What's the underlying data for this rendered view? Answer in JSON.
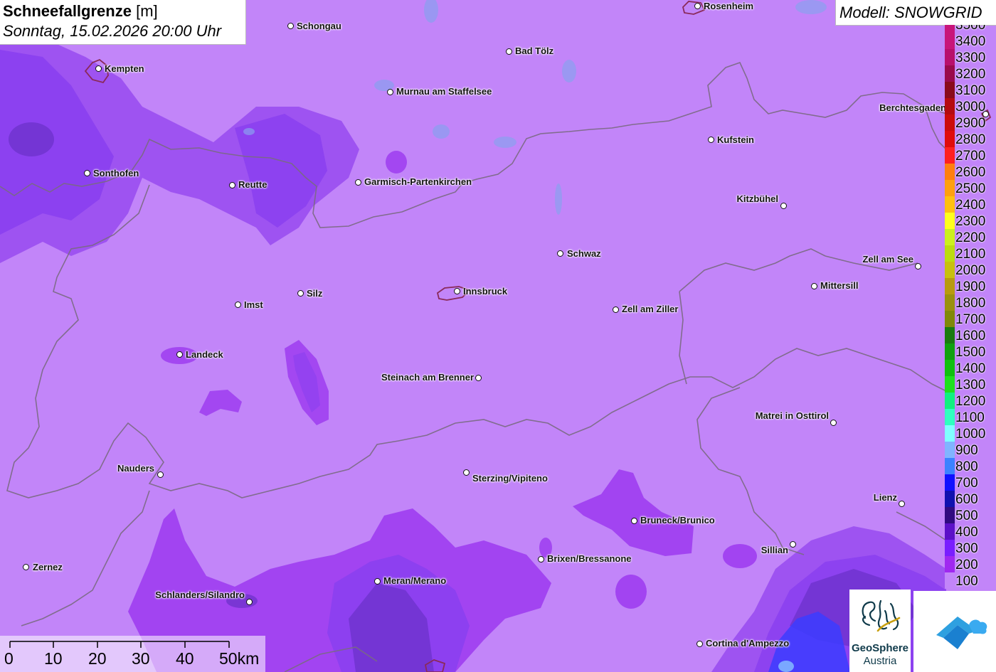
{
  "title": {
    "main": "Schneefallgrenze",
    "unit": "[m]",
    "datetime": "Sonntag, 15.02.2026 20:00 Uhr"
  },
  "model_label": "Modell: SNOWGRID",
  "legend": [
    {
      "value": "3500",
      "color": "#c8157a"
    },
    {
      "value": "3400",
      "color": "#c8157a"
    },
    {
      "value": "3300",
      "color": "#b80f6c"
    },
    {
      "value": "3200",
      "color": "#9a0a4c"
    },
    {
      "value": "3100",
      "color": "#8a0a1c"
    },
    {
      "value": "3000",
      "color": "#b50a10"
    },
    {
      "value": "2900",
      "color": "#cc0b0b"
    },
    {
      "value": "2800",
      "color": "#e00c0c"
    },
    {
      "value": "2700",
      "color": "#ff2020"
    },
    {
      "value": "2600",
      "color": "#ff7f10"
    },
    {
      "value": "2500",
      "color": "#ffa010"
    },
    {
      "value": "2400",
      "color": "#ffc010"
    },
    {
      "value": "2300",
      "color": "#ffff1e"
    },
    {
      "value": "2200",
      "color": "#ccf01e"
    },
    {
      "value": "2100",
      "color": "#bcdc10"
    },
    {
      "value": "2000",
      "color": "#c8c010"
    },
    {
      "value": "1900",
      "color": "#b89a10"
    },
    {
      "value": "1800",
      "color": "#9a9010"
    },
    {
      "value": "1700",
      "color": "#80880a"
    },
    {
      "value": "1600",
      "color": "#1a7a10"
    },
    {
      "value": "1500",
      "color": "#10a010"
    },
    {
      "value": "1400",
      "color": "#10c010"
    },
    {
      "value": "1300",
      "color": "#1ee01e"
    },
    {
      "value": "1200",
      "color": "#10f080"
    },
    {
      "value": "1100",
      "color": "#30ffc0"
    },
    {
      "value": "1000",
      "color": "#80ffff"
    },
    {
      "value": "900",
      "color": "#80b4ff"
    },
    {
      "value": "800",
      "color": "#3c82ff"
    },
    {
      "value": "700",
      "color": "#1010ff"
    },
    {
      "value": "600",
      "color": "#1010b0"
    },
    {
      "value": "500",
      "color": "#300a80"
    },
    {
      "value": "400",
      "color": "#5c10c8"
    },
    {
      "value": "300",
      "color": "#7a1eff"
    },
    {
      "value": "200",
      "color": "#a028f0"
    },
    {
      "value": "100",
      "color": "#c285f9"
    }
  ],
  "cities": [
    {
      "name": "Rosenheim",
      "label_side": "right"
    },
    {
      "name": "Schongau",
      "label_side": "right"
    },
    {
      "name": "Bad Tölz",
      "label_side": "right"
    },
    {
      "name": "Kempten",
      "label_side": "right"
    },
    {
      "name": "Murnau am Staffelsee",
      "label_side": "right"
    },
    {
      "name": "Berchtesgaden",
      "label_side": "left"
    },
    {
      "name": "Kufstein",
      "label_side": "right"
    },
    {
      "name": "Sonthofen",
      "label_side": "right"
    },
    {
      "name": "Reutte",
      "label_side": "right"
    },
    {
      "name": "Garmisch-Partenkirchen",
      "label_side": "right"
    },
    {
      "name": "Kitzbühel",
      "label_side": "left"
    },
    {
      "name": "Schwaz",
      "label_side": "right"
    },
    {
      "name": "Zell am See",
      "label_side": "left"
    },
    {
      "name": "Mittersill",
      "label_side": "right"
    },
    {
      "name": "Innsbruck",
      "label_side": "right"
    },
    {
      "name": "Silz",
      "label_side": "right"
    },
    {
      "name": "Imst",
      "label_side": "right"
    },
    {
      "name": "Zell am Ziller",
      "label_side": "right"
    },
    {
      "name": "Landeck",
      "label_side": "right"
    },
    {
      "name": "Steinach am Brenner",
      "label_side": "left"
    },
    {
      "name": "Matrei in Osttirol",
      "label_side": "left"
    },
    {
      "name": "Nauders",
      "label_side": "left"
    },
    {
      "name": "Sterzing/Vipiteno",
      "label_side": "right"
    },
    {
      "name": "Lienz",
      "label_side": "left"
    },
    {
      "name": "Bruneck/Brunico",
      "label_side": "right"
    },
    {
      "name": "Sillian",
      "label_side": "left"
    },
    {
      "name": "Brixen/Bressanone",
      "label_side": "right"
    },
    {
      "name": "Zernez",
      "label_side": "right"
    },
    {
      "name": "Meran/Merano",
      "label_side": "right"
    },
    {
      "name": "Schlanders/Silandro",
      "label_side": "left"
    },
    {
      "name": "Cortina d'Ampezzo",
      "label_side": "right"
    }
  ],
  "scale_bar": {
    "labels": [
      "0",
      "10",
      "20",
      "30",
      "40",
      "50km"
    ]
  },
  "logos": {
    "geosphere_name": "GeoSphere",
    "geosphere_sub": "Austria"
  },
  "colors": {
    "base_fill": "#c285f9",
    "zone_200": "#a040f0",
    "zone_300": "#8a3ff0",
    "zone_400": "#6a30c8",
    "zone_700": "#3c3cff",
    "border_line": "#7a6a82",
    "city_outline": "#8a2a5a"
  }
}
